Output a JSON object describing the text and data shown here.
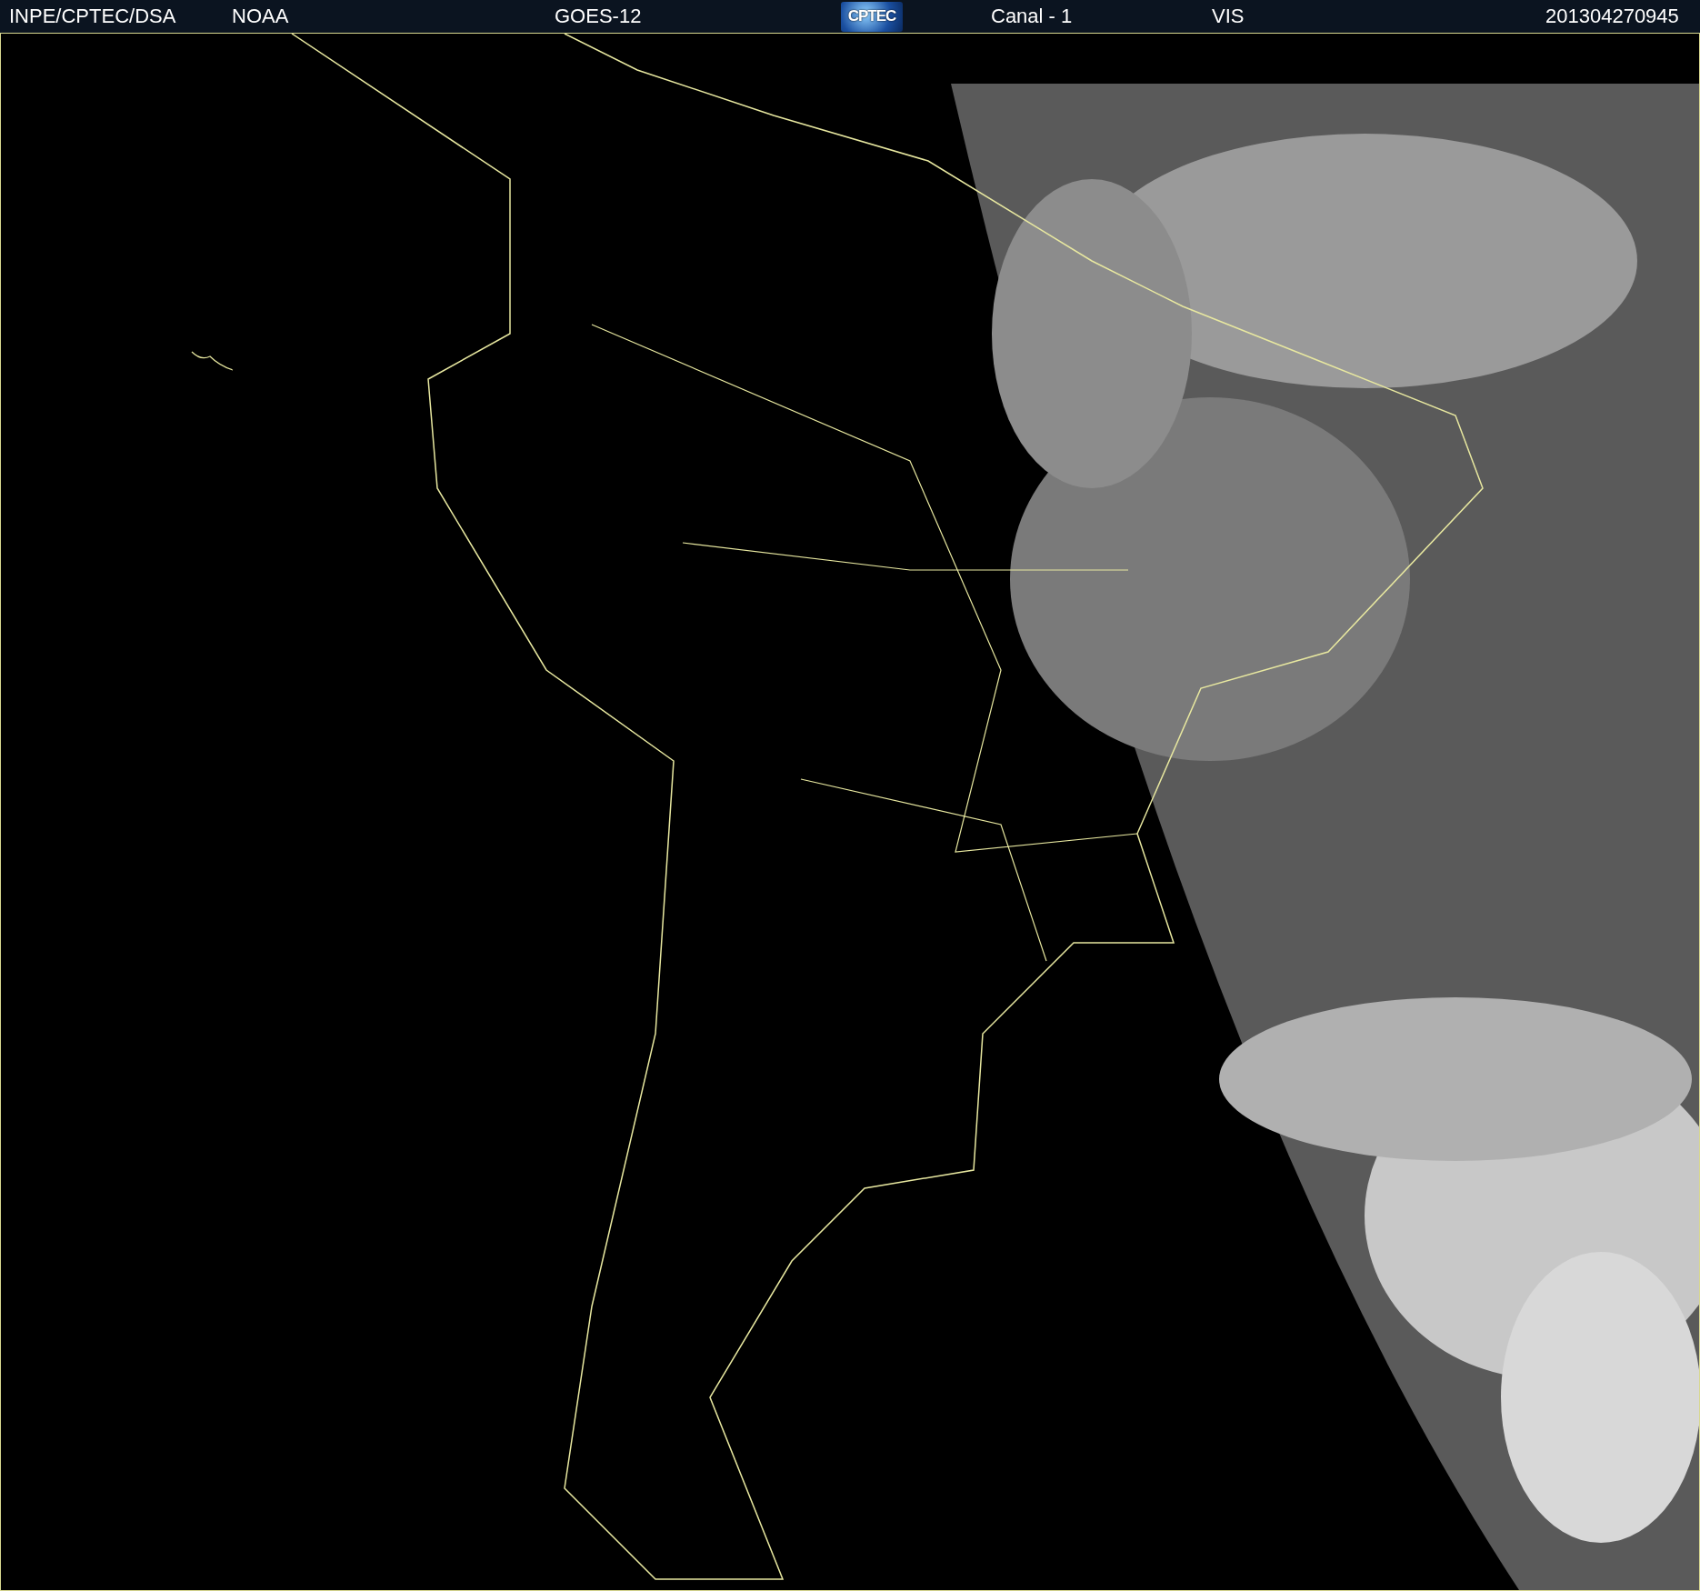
{
  "header": {
    "source": "INPE/CPTEC/DSA",
    "agency": "NOAA",
    "satellite": "GOES-12",
    "logo": "CPTEC",
    "channel": "Canal - 1",
    "band": "VIS",
    "timestamp": "201304270945"
  }
}
